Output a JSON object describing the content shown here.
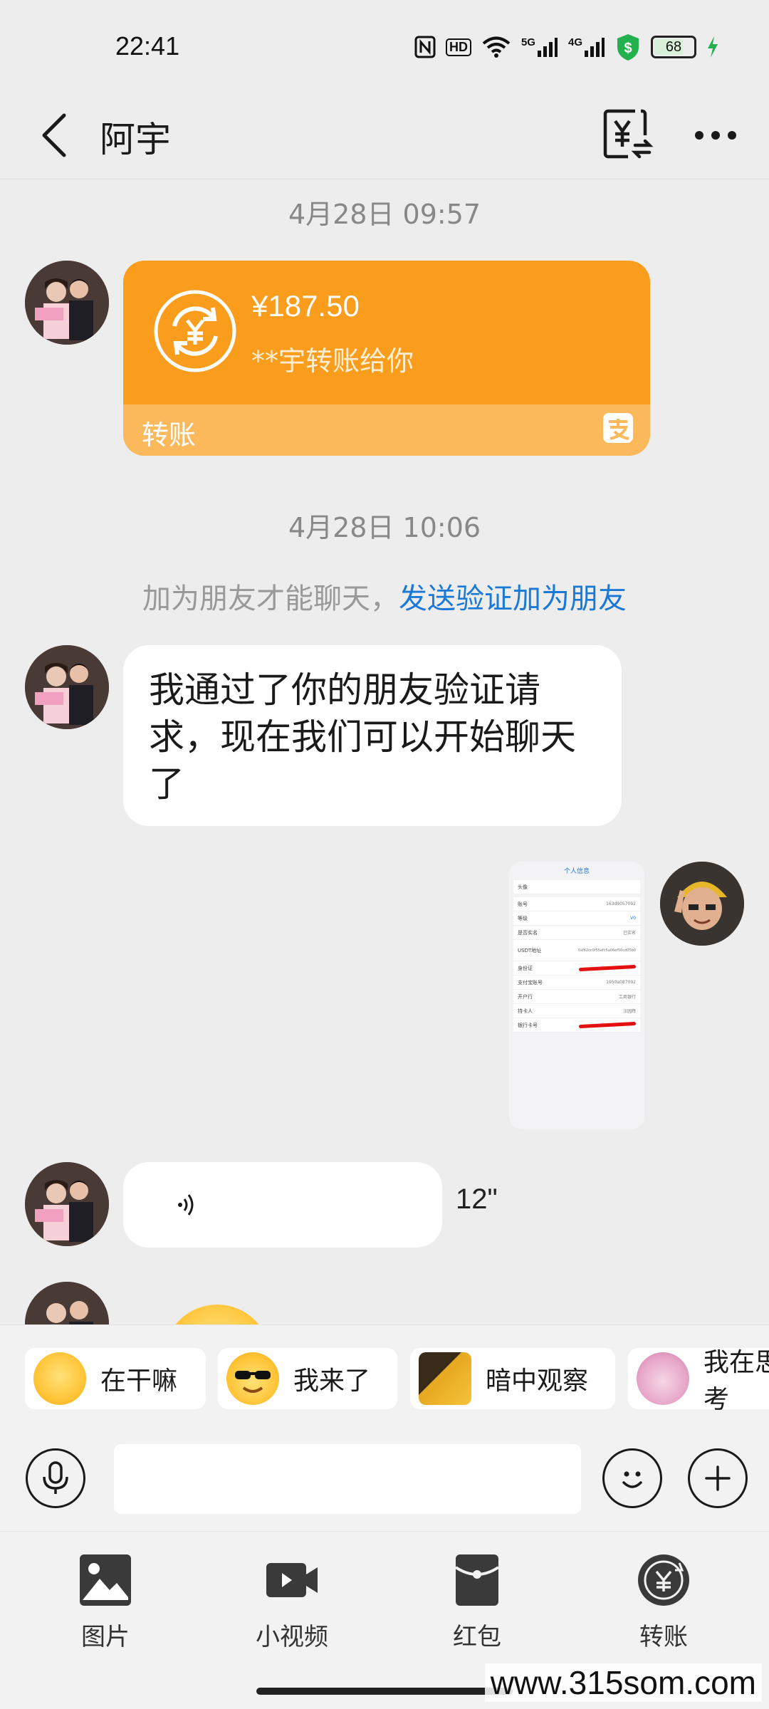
{
  "status_bar": {
    "time": "22:41",
    "hd_label": "HD",
    "net1": "5G",
    "net2": "4G",
    "battery": "68"
  },
  "header": {
    "title": "阿宇"
  },
  "messages": {
    "ts1": "4月28日 09:57",
    "transfer": {
      "amount": "¥187.50",
      "description": "**宇转账给你",
      "type_label": "转账"
    },
    "ts2": "4月28日 10:06",
    "notice_text": "加为朋友才能聊天，",
    "notice_link": "发送验证加为朋友",
    "text_message": "我通过了你的朋友验证请求，现在我们可以开始聊天了",
    "voice_duration": "12\"",
    "screenshot": {
      "title": "个人信息",
      "rows": [
        {
          "label": "头像",
          "value": ""
        },
        {
          "label": "账号",
          "value": "163d9057092"
        },
        {
          "label": "等级",
          "value": "V0"
        },
        {
          "label": "是否实名",
          "value": "已实名"
        },
        {
          "label": "USDT地址",
          "value": "0xf82cc0f55efc5a06ef50cd05b0"
        },
        {
          "label": "身份证",
          "value": ""
        },
        {
          "label": "支付宝账号",
          "value": "1950a087092"
        },
        {
          "label": "开户行",
          "value": "工商银行"
        },
        {
          "label": "持卡人",
          "value": "汪园辉"
        },
        {
          "label": "银行卡号",
          "value": ""
        }
      ]
    }
  },
  "stickers": [
    {
      "label": "在干嘛",
      "icon": "sticker-what-doing",
      "color": "#ffcc4d"
    },
    {
      "label": "我来了",
      "icon": "sticker-sunglasses",
      "color": "#ffcc4d"
    },
    {
      "label": "暗中观察",
      "icon": "sticker-peek",
      "color": "#e0a020"
    },
    {
      "label": "我在思考",
      "icon": "sticker-thinking",
      "color": "#f7c6d8"
    }
  ],
  "functions": [
    {
      "label": "图片",
      "icon": "image-icon"
    },
    {
      "label": "小视频",
      "icon": "video-icon"
    },
    {
      "label": "红包",
      "icon": "red-packet-icon"
    },
    {
      "label": "转账",
      "icon": "transfer-icon"
    }
  ],
  "watermark": "www.315som.com",
  "colors": {
    "transfer_orange": "#fa9d1d",
    "link_blue": "#1a79d6",
    "background": "#ededed"
  }
}
